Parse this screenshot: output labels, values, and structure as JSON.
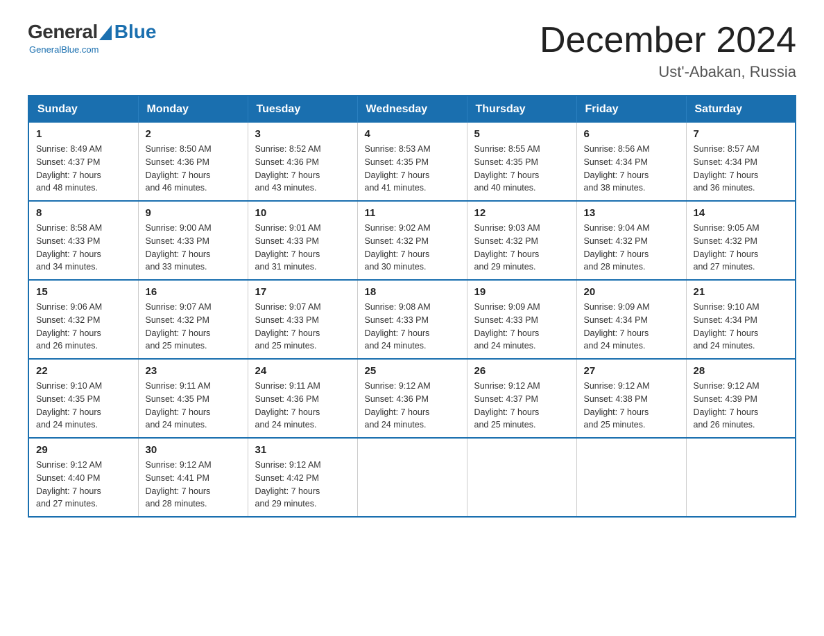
{
  "header": {
    "logo": {
      "general": "General",
      "blue": "Blue",
      "tagline": "GeneralBlue.com"
    },
    "title": "December 2024",
    "location": "Ust'-Abakan, Russia"
  },
  "days_of_week": [
    "Sunday",
    "Monday",
    "Tuesday",
    "Wednesday",
    "Thursday",
    "Friday",
    "Saturday"
  ],
  "weeks": [
    [
      {
        "day": "1",
        "sunrise": "Sunrise: 8:49 AM",
        "sunset": "Sunset: 4:37 PM",
        "daylight": "Daylight: 7 hours",
        "daylight2": "and 48 minutes."
      },
      {
        "day": "2",
        "sunrise": "Sunrise: 8:50 AM",
        "sunset": "Sunset: 4:36 PM",
        "daylight": "Daylight: 7 hours",
        "daylight2": "and 46 minutes."
      },
      {
        "day": "3",
        "sunrise": "Sunrise: 8:52 AM",
        "sunset": "Sunset: 4:36 PM",
        "daylight": "Daylight: 7 hours",
        "daylight2": "and 43 minutes."
      },
      {
        "day": "4",
        "sunrise": "Sunrise: 8:53 AM",
        "sunset": "Sunset: 4:35 PM",
        "daylight": "Daylight: 7 hours",
        "daylight2": "and 41 minutes."
      },
      {
        "day": "5",
        "sunrise": "Sunrise: 8:55 AM",
        "sunset": "Sunset: 4:35 PM",
        "daylight": "Daylight: 7 hours",
        "daylight2": "and 40 minutes."
      },
      {
        "day": "6",
        "sunrise": "Sunrise: 8:56 AM",
        "sunset": "Sunset: 4:34 PM",
        "daylight": "Daylight: 7 hours",
        "daylight2": "and 38 minutes."
      },
      {
        "day": "7",
        "sunrise": "Sunrise: 8:57 AM",
        "sunset": "Sunset: 4:34 PM",
        "daylight": "Daylight: 7 hours",
        "daylight2": "and 36 minutes."
      }
    ],
    [
      {
        "day": "8",
        "sunrise": "Sunrise: 8:58 AM",
        "sunset": "Sunset: 4:33 PM",
        "daylight": "Daylight: 7 hours",
        "daylight2": "and 34 minutes."
      },
      {
        "day": "9",
        "sunrise": "Sunrise: 9:00 AM",
        "sunset": "Sunset: 4:33 PM",
        "daylight": "Daylight: 7 hours",
        "daylight2": "and 33 minutes."
      },
      {
        "day": "10",
        "sunrise": "Sunrise: 9:01 AM",
        "sunset": "Sunset: 4:33 PM",
        "daylight": "Daylight: 7 hours",
        "daylight2": "and 31 minutes."
      },
      {
        "day": "11",
        "sunrise": "Sunrise: 9:02 AM",
        "sunset": "Sunset: 4:32 PM",
        "daylight": "Daylight: 7 hours",
        "daylight2": "and 30 minutes."
      },
      {
        "day": "12",
        "sunrise": "Sunrise: 9:03 AM",
        "sunset": "Sunset: 4:32 PM",
        "daylight": "Daylight: 7 hours",
        "daylight2": "and 29 minutes."
      },
      {
        "day": "13",
        "sunrise": "Sunrise: 9:04 AM",
        "sunset": "Sunset: 4:32 PM",
        "daylight": "Daylight: 7 hours",
        "daylight2": "and 28 minutes."
      },
      {
        "day": "14",
        "sunrise": "Sunrise: 9:05 AM",
        "sunset": "Sunset: 4:32 PM",
        "daylight": "Daylight: 7 hours",
        "daylight2": "and 27 minutes."
      }
    ],
    [
      {
        "day": "15",
        "sunrise": "Sunrise: 9:06 AM",
        "sunset": "Sunset: 4:32 PM",
        "daylight": "Daylight: 7 hours",
        "daylight2": "and 26 minutes."
      },
      {
        "day": "16",
        "sunrise": "Sunrise: 9:07 AM",
        "sunset": "Sunset: 4:32 PM",
        "daylight": "Daylight: 7 hours",
        "daylight2": "and 25 minutes."
      },
      {
        "day": "17",
        "sunrise": "Sunrise: 9:07 AM",
        "sunset": "Sunset: 4:33 PM",
        "daylight": "Daylight: 7 hours",
        "daylight2": "and 25 minutes."
      },
      {
        "day": "18",
        "sunrise": "Sunrise: 9:08 AM",
        "sunset": "Sunset: 4:33 PM",
        "daylight": "Daylight: 7 hours",
        "daylight2": "and 24 minutes."
      },
      {
        "day": "19",
        "sunrise": "Sunrise: 9:09 AM",
        "sunset": "Sunset: 4:33 PM",
        "daylight": "Daylight: 7 hours",
        "daylight2": "and 24 minutes."
      },
      {
        "day": "20",
        "sunrise": "Sunrise: 9:09 AM",
        "sunset": "Sunset: 4:34 PM",
        "daylight": "Daylight: 7 hours",
        "daylight2": "and 24 minutes."
      },
      {
        "day": "21",
        "sunrise": "Sunrise: 9:10 AM",
        "sunset": "Sunset: 4:34 PM",
        "daylight": "Daylight: 7 hours",
        "daylight2": "and 24 minutes."
      }
    ],
    [
      {
        "day": "22",
        "sunrise": "Sunrise: 9:10 AM",
        "sunset": "Sunset: 4:35 PM",
        "daylight": "Daylight: 7 hours",
        "daylight2": "and 24 minutes."
      },
      {
        "day": "23",
        "sunrise": "Sunrise: 9:11 AM",
        "sunset": "Sunset: 4:35 PM",
        "daylight": "Daylight: 7 hours",
        "daylight2": "and 24 minutes."
      },
      {
        "day": "24",
        "sunrise": "Sunrise: 9:11 AM",
        "sunset": "Sunset: 4:36 PM",
        "daylight": "Daylight: 7 hours",
        "daylight2": "and 24 minutes."
      },
      {
        "day": "25",
        "sunrise": "Sunrise: 9:12 AM",
        "sunset": "Sunset: 4:36 PM",
        "daylight": "Daylight: 7 hours",
        "daylight2": "and 24 minutes."
      },
      {
        "day": "26",
        "sunrise": "Sunrise: 9:12 AM",
        "sunset": "Sunset: 4:37 PM",
        "daylight": "Daylight: 7 hours",
        "daylight2": "and 25 minutes."
      },
      {
        "day": "27",
        "sunrise": "Sunrise: 9:12 AM",
        "sunset": "Sunset: 4:38 PM",
        "daylight": "Daylight: 7 hours",
        "daylight2": "and 25 minutes."
      },
      {
        "day": "28",
        "sunrise": "Sunrise: 9:12 AM",
        "sunset": "Sunset: 4:39 PM",
        "daylight": "Daylight: 7 hours",
        "daylight2": "and 26 minutes."
      }
    ],
    [
      {
        "day": "29",
        "sunrise": "Sunrise: 9:12 AM",
        "sunset": "Sunset: 4:40 PM",
        "daylight": "Daylight: 7 hours",
        "daylight2": "and 27 minutes."
      },
      {
        "day": "30",
        "sunrise": "Sunrise: 9:12 AM",
        "sunset": "Sunset: 4:41 PM",
        "daylight": "Daylight: 7 hours",
        "daylight2": "and 28 minutes."
      },
      {
        "day": "31",
        "sunrise": "Sunrise: 9:12 AM",
        "sunset": "Sunset: 4:42 PM",
        "daylight": "Daylight: 7 hours",
        "daylight2": "and 29 minutes."
      },
      null,
      null,
      null,
      null
    ]
  ]
}
